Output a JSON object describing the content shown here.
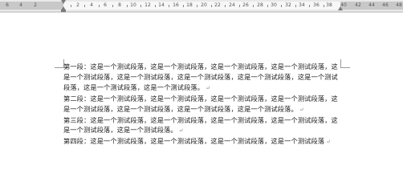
{
  "ruler": {
    "labels": [
      "6",
      "4",
      "2",
      "2",
      "4",
      "6",
      "8",
      "10",
      "12",
      "14",
      "16",
      "18",
      "20",
      "22",
      "24",
      "26",
      "28",
      "30",
      "32",
      "34",
      "36",
      "38",
      "40",
      "42",
      "44",
      "46",
      "48"
    ]
  },
  "document": {
    "paragraph_mark": "↵",
    "paragraphs": [
      {
        "text": "第一段：这是一个测试段落，这是一个测试段落，这是一个测试段落，这是一个测试段落，这是一个测试段落，这是一个测试段落，这是一个测试段落，这是一个测试段落，这是一个测试段落，这是一个测试段落，这是一个测试段落。"
      },
      {
        "text": "第二段：这是一个测试段落，这是一个测试段落，这是一个测试段落，这是一个测试段落，这是一个测试段落，这是一个测试段落，这是一个测试段落，这是一个测试段落。"
      },
      {
        "text": "第三段：这是一个测试段落，这是一个测试段落，这是一个测试段落，这是一个测试段落，这是一个测试段落，这是一个测试段落。"
      },
      {
        "text": "第四段：这是一个测试段落，这是一个测试段落，这是一个测试段落，这是一个测试段落"
      }
    ]
  }
}
